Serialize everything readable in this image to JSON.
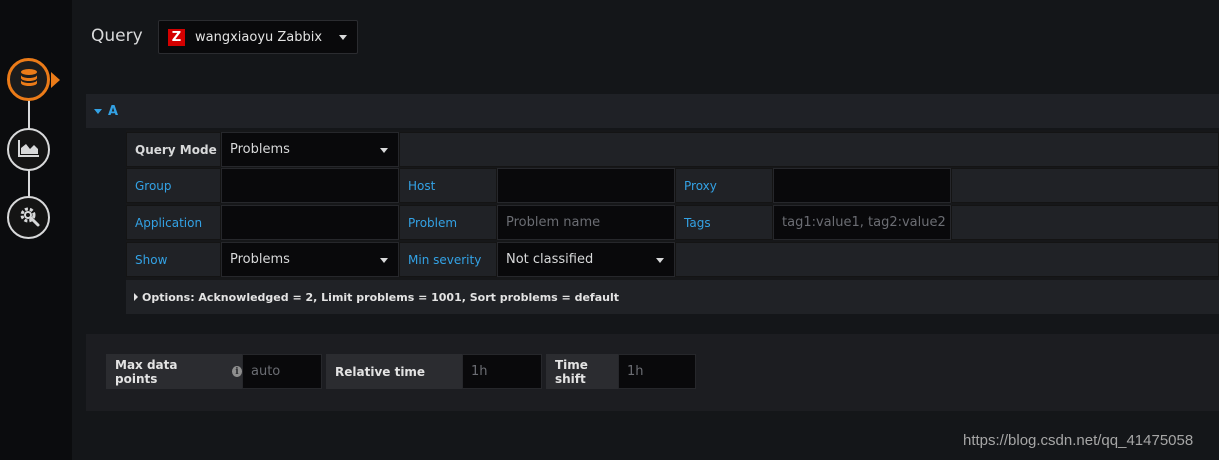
{
  "query": {
    "title": "Query",
    "datasource": "wangxiaoyu Zabbix",
    "datasource_logo": "Z"
  },
  "rail": {
    "items": [
      {
        "icon": "database-icon",
        "active": true
      },
      {
        "icon": "chart-icon",
        "active": false
      },
      {
        "icon": "settings-icon",
        "active": false
      }
    ]
  },
  "row": {
    "label": "A"
  },
  "editor": {
    "query_mode_label": "Query Mode",
    "query_mode_value": "Problems",
    "group_label": "Group",
    "group_value": "",
    "host_label": "Host",
    "host_value": "",
    "proxy_label": "Proxy",
    "proxy_value": "",
    "application_label": "Application",
    "application_value": "",
    "problem_label": "Problem",
    "problem_placeholder": "Problem name",
    "tags_label": "Tags",
    "tags_placeholder": "tag1:value1, tag2:value2",
    "show_label": "Show",
    "show_value": "Problems",
    "severity_label": "Min severity",
    "severity_value": "Not classified",
    "options_text": "Options: Acknowledged = 2, Limit problems = 1001, Sort problems = default"
  },
  "bottom": {
    "max_points_label": "Max data points",
    "max_points_placeholder": "auto",
    "relative_time_label": "Relative time",
    "relative_time_placeholder": "1h",
    "time_shift_label": "Time shift",
    "time_shift_placeholder": "1h"
  },
  "watermark": "https://blog.csdn.net/qq_41475058",
  "colors": {
    "accent_blue": "#33a2e5",
    "active_orange": "#eb7b18",
    "zabbix_red": "#d40000"
  }
}
